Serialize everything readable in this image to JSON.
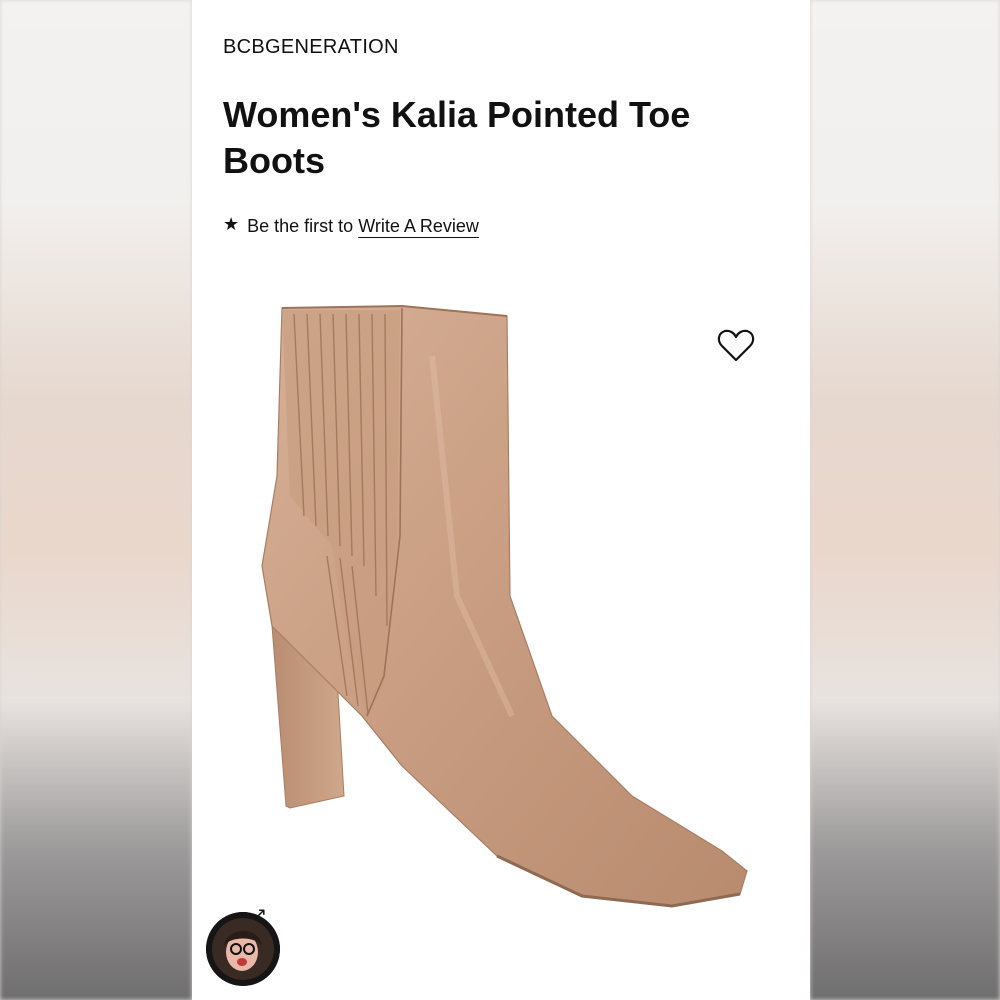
{
  "product": {
    "brand": "BCBGENERATION",
    "title": "Women's Kalia Pointed Toe Boots",
    "review_prompt": "Be the first to",
    "review_link": "Write A Review",
    "color": "#c8a084"
  },
  "icons": {
    "rating": "star-icon",
    "wishlist": "heart-icon",
    "overlay_badge": "arrow-icon"
  }
}
